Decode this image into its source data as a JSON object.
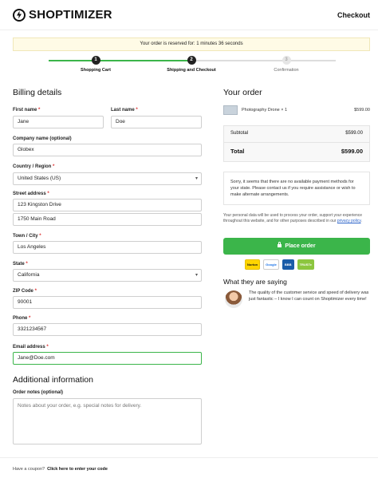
{
  "header": {
    "brand": "SHOPTIMIZER",
    "checkout": "Checkout"
  },
  "notice": "Your order is reserved for: 1 minutes 36 seconds",
  "steps": [
    {
      "num": "1",
      "label": "Shopping Cart"
    },
    {
      "num": "2",
      "label": "Shipping and Checkout"
    },
    {
      "num": "3",
      "label": "Confirmation"
    }
  ],
  "billing": {
    "title": "Billing details",
    "first_name_label": "First name",
    "first_name": "Jane",
    "last_name_label": "Last name",
    "last_name": "Doe",
    "company_label": "Company name (optional)",
    "company": "Globex",
    "country_label": "Country / Region",
    "country": "United States (US)",
    "street_label": "Street address",
    "street1": "123 Kingston Drive",
    "street2": "1750 Main Road",
    "city_label": "Town / City",
    "city": "Los Angeles",
    "state_label": "State",
    "state": "California",
    "zip_label": "ZIP Code",
    "zip": "90001",
    "phone_label": "Phone",
    "phone": "3321234567",
    "email_label": "Email address",
    "email": "Jane@Doe.com",
    "required": "*"
  },
  "additional": {
    "title": "Additional information",
    "notes_label": "Order notes (optional)",
    "notes_placeholder": "Notes about your order, e.g. special notes for delivery."
  },
  "order": {
    "title": "Your order",
    "item_name": "Photography Drone  × 1",
    "item_price": "$599.00",
    "subtotal_label": "Subtotal",
    "subtotal": "$599.00",
    "total_label": "Total",
    "total": "$599.00",
    "payment_message": "Sorry, it seems that there are no available payment methods for your state. Please contact us if you require assistance or wish to make alternate arrangements.",
    "privacy_text": "Your personal data will be used to process your order, support your experience throughout this website, and for other purposes described in our",
    "privacy_link": "privacy policy",
    "privacy_end": ".",
    "place_order": "Place order"
  },
  "badges": [
    "Norton",
    "Google",
    "BBB",
    "TRUSTe"
  ],
  "testimonial": {
    "title": "What they are saying",
    "text": "The quality of the customer service and speed of delivery was just fantastic – I know I can count on Shoptimizer every time!"
  },
  "coupon": {
    "prompt": "Have a coupon?",
    "link": "Click here to enter your code"
  },
  "colors": {
    "accent": "#3bb54a",
    "notice_bg": "#fffbe6",
    "link": "#2a62c9"
  }
}
